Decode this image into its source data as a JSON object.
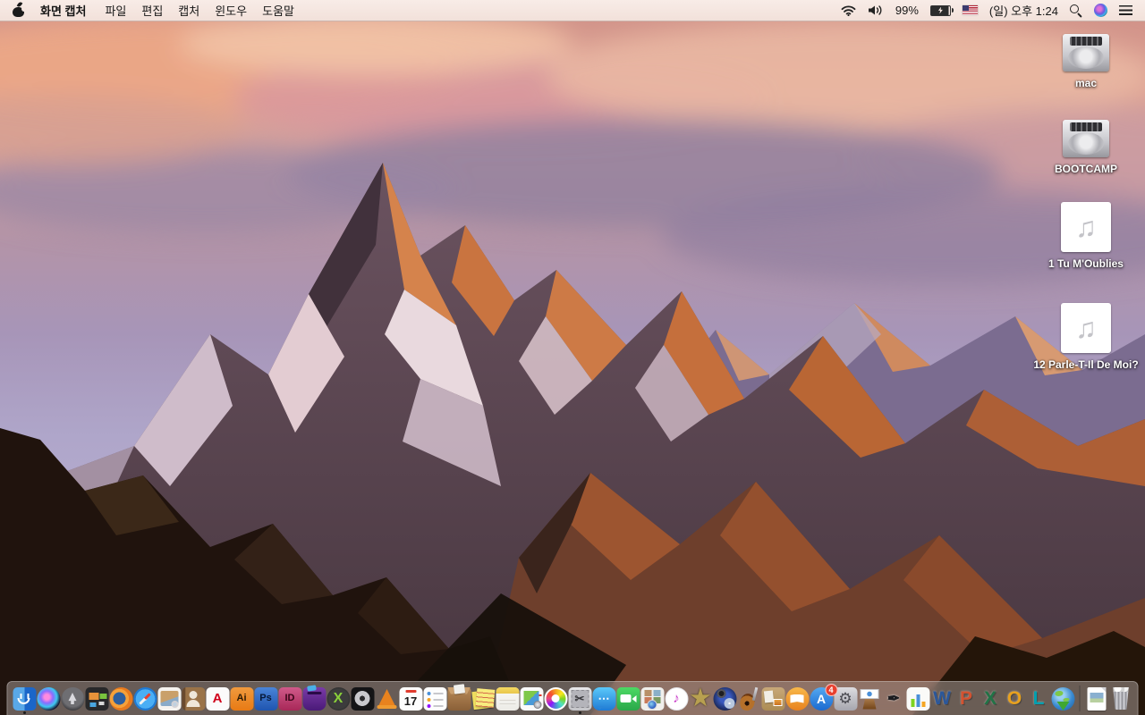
{
  "menubar": {
    "app_name": "화면 캡처",
    "menus": [
      "파일",
      "편집",
      "캡처",
      "윈도우",
      "도움말"
    ],
    "status": {
      "battery_percent": "99%",
      "clock": "(일) 오후 1:24"
    },
    "status_icons": [
      "wifi-icon",
      "volume-icon",
      "battery-charging-icon",
      "us-flag-icon",
      "spotlight-search-icon",
      "siri-icon",
      "notification-center-icon"
    ],
    "colors": {
      "bar_bg": "#f5e6e0",
      "text": "#161616"
    }
  },
  "desktop": {
    "icons": [
      {
        "name": "drive-mac",
        "type": "drive",
        "label": "mac"
      },
      {
        "name": "drive-bootcamp",
        "type": "drive",
        "label": "BOOTCAMP"
      },
      {
        "name": "audio-file-1",
        "type": "audio",
        "label": "1 Tu M'Oublies"
      },
      {
        "name": "audio-file-2",
        "type": "audio",
        "label": "12 Parle-T-Il De Moi?"
      }
    ],
    "audio_note_glyph": "♫"
  },
  "dock": {
    "items": [
      {
        "name": "finder",
        "cls": "ic-finder",
        "running": true
      },
      {
        "name": "siri",
        "cls": "ic-siri"
      },
      {
        "name": "launchpad",
        "cls": "ic-launchpad"
      },
      {
        "name": "mission-control",
        "cls": "ic-mc"
      },
      {
        "name": "firefox",
        "cls": "ic-firefox"
      },
      {
        "name": "safari",
        "cls": "ic-safari"
      },
      {
        "name": "preview",
        "cls": "ic-preview"
      },
      {
        "name": "contacts",
        "cls": "ic-contacts"
      },
      {
        "name": "acrobat-reader",
        "cls": "ic-acrobat",
        "glyph": "A"
      },
      {
        "name": "illustrator",
        "cls": "ic-ai",
        "glyph": "Ai"
      },
      {
        "name": "photoshop",
        "cls": "ic-ps",
        "glyph": "Ps"
      },
      {
        "name": "indesign",
        "cls": "ic-id",
        "glyph": "ID"
      },
      {
        "name": "toast",
        "cls": "ic-toast"
      },
      {
        "name": "x-app",
        "cls": "ic-xgreen",
        "glyph": "X"
      },
      {
        "name": "disk-tool",
        "cls": "ic-disktool"
      },
      {
        "name": "vlc",
        "cls": "ic-vlc"
      },
      {
        "name": "calendar",
        "cls": "ic-calendar",
        "glyph": "17"
      },
      {
        "name": "reminders",
        "cls": "ic-reminders"
      },
      {
        "name": "unarchiver",
        "cls": "ic-unarchiver"
      },
      {
        "name": "stickies",
        "cls": "ic-stickies"
      },
      {
        "name": "notes",
        "cls": "ic-notes"
      },
      {
        "name": "image-capture",
        "cls": "ic-docviewer"
      },
      {
        "name": "photos",
        "cls": "ic-photos"
      },
      {
        "name": "screen-capture-grab",
        "cls": "ic-grab",
        "glyph": "✂",
        "running": true
      },
      {
        "name": "messages",
        "cls": "ic-messages",
        "glyph": "⋯"
      },
      {
        "name": "facetime",
        "cls": "ic-facetime"
      },
      {
        "name": "photo-booth",
        "cls": "ic-photobooth"
      },
      {
        "name": "itunes",
        "cls": "ic-itunes",
        "glyph": "♪"
      },
      {
        "name": "imovie",
        "cls": "ic-imovie",
        "glyph": "★"
      },
      {
        "name": "idvd",
        "cls": "ic-idvd"
      },
      {
        "name": "garageband",
        "cls": "ic-garageband"
      },
      {
        "name": "scrapbook",
        "cls": "ic-corkboard"
      },
      {
        "name": "ibooks",
        "cls": "ic-ibooks"
      },
      {
        "name": "app-store",
        "cls": "ic-appstore",
        "glyph": "A",
        "badge": "4"
      },
      {
        "name": "system-preferences",
        "cls": "ic-sysprefs",
        "glyph": "⚙"
      },
      {
        "name": "keynote",
        "cls": "ic-keynote"
      },
      {
        "name": "pages",
        "cls": "ic-pages",
        "glyph": "✒"
      },
      {
        "name": "numbers",
        "cls": "ic-numbers"
      },
      {
        "name": "word",
        "cls": "ic-word",
        "glyph": "W"
      },
      {
        "name": "powerpoint",
        "cls": "ic-ppt",
        "glyph": "P"
      },
      {
        "name": "excel",
        "cls": "ic-excel",
        "glyph": "X"
      },
      {
        "name": "outlook",
        "cls": "ic-outlook",
        "glyph": "O"
      },
      {
        "name": "lync",
        "cls": "ic-lync",
        "glyph": "L"
      },
      {
        "name": "downloader",
        "cls": "ic-globedl"
      },
      {
        "type": "sep"
      },
      {
        "name": "document",
        "cls": "ic-dockdoc"
      },
      {
        "name": "trash-full",
        "cls": "ic-trash"
      }
    ],
    "app_store_badge": "4",
    "calendar_day": "17"
  }
}
